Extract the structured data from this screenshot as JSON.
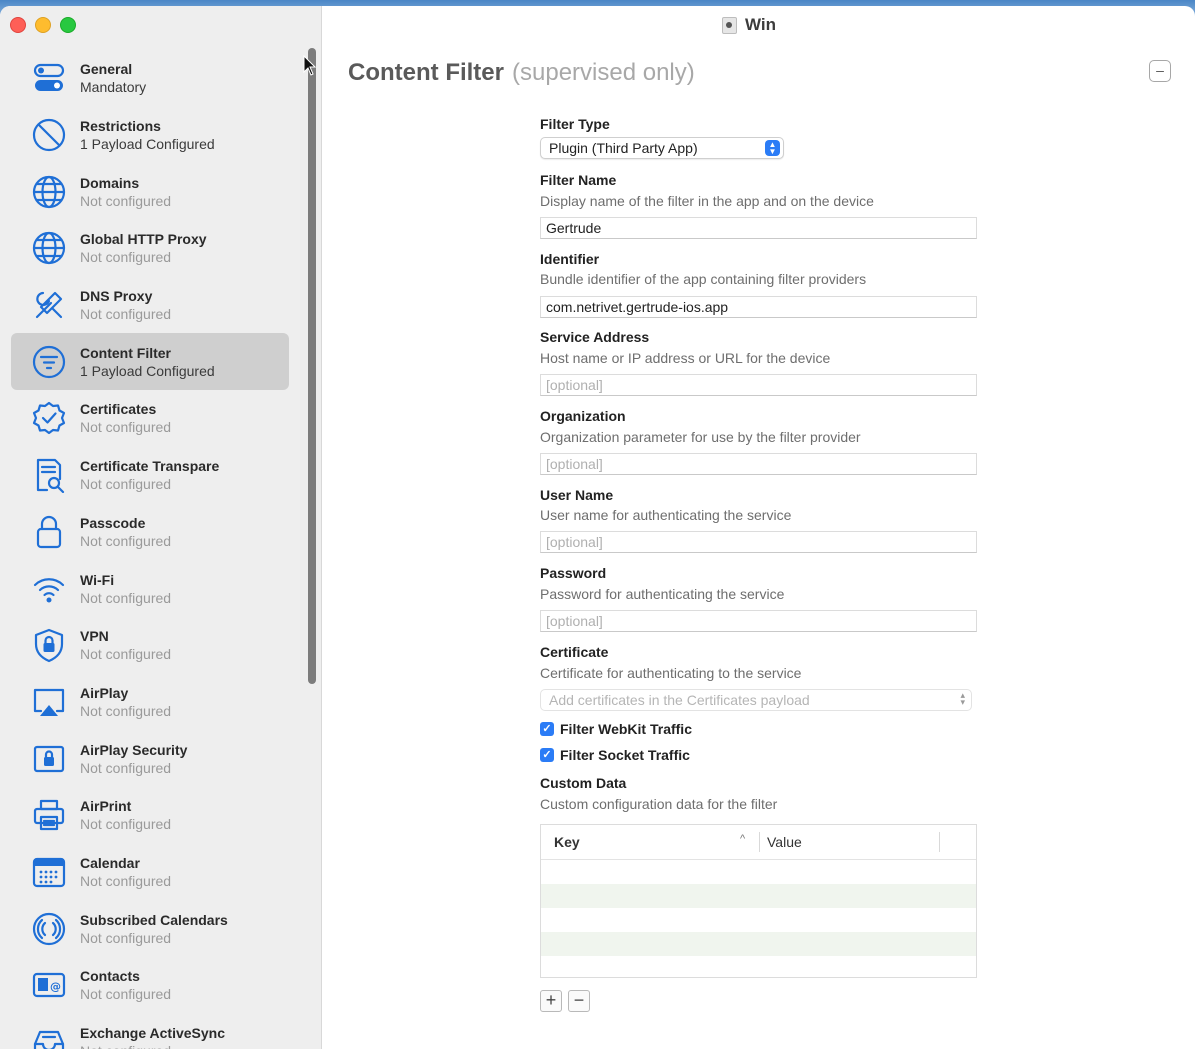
{
  "window": {
    "title": "Win"
  },
  "sidebar": {
    "items": [
      {
        "title": "General",
        "subtitle": "Mandatory",
        "icon": "toggle-icon",
        "configured": true
      },
      {
        "title": "Restrictions",
        "subtitle": "1 Payload Configured",
        "icon": "no-entry-icon",
        "configured": true
      },
      {
        "title": "Domains",
        "subtitle": "Not configured",
        "icon": "globe-icon",
        "configured": false
      },
      {
        "title": "Global HTTP Proxy",
        "subtitle": "Not configured",
        "icon": "globe-icon",
        "configured": false
      },
      {
        "title": "DNS Proxy",
        "subtitle": "Not configured",
        "icon": "tools-icon",
        "configured": false
      },
      {
        "title": "Content Filter",
        "subtitle": "1 Payload Configured",
        "icon": "filter-icon",
        "configured": true,
        "selected": true
      },
      {
        "title": "Certificates",
        "subtitle": "Not configured",
        "icon": "checkmark-seal-icon",
        "configured": false
      },
      {
        "title": "Certificate Transpare",
        "subtitle": "Not configured",
        "icon": "document-magnifier-icon",
        "configured": false
      },
      {
        "title": "Passcode",
        "subtitle": "Not configured",
        "icon": "lock-icon",
        "configured": false
      },
      {
        "title": "Wi-Fi",
        "subtitle": "Not configured",
        "icon": "wifi-icon",
        "configured": false
      },
      {
        "title": "VPN",
        "subtitle": "Not configured",
        "icon": "shield-lock-icon",
        "configured": false
      },
      {
        "title": "AirPlay",
        "subtitle": "Not configured",
        "icon": "airplay-icon",
        "configured": false
      },
      {
        "title": "AirPlay Security",
        "subtitle": "Not configured",
        "icon": "airplay-lock-icon",
        "configured": false
      },
      {
        "title": "AirPrint",
        "subtitle": "Not configured",
        "icon": "printer-icon",
        "configured": false
      },
      {
        "title": "Calendar",
        "subtitle": "Not configured",
        "icon": "calendar-icon",
        "configured": false
      },
      {
        "title": "Subscribed Calendars",
        "subtitle": "Not configured",
        "icon": "broadcast-icon",
        "configured": false
      },
      {
        "title": "Contacts",
        "subtitle": "Not configured",
        "icon": "contact-card-icon",
        "configured": false
      },
      {
        "title": "Exchange ActiveSync",
        "subtitle": "Not configured",
        "icon": "tray-icon",
        "configured": false
      }
    ]
  },
  "content": {
    "heading": "Content Filter",
    "heading_note": "(supervised only)",
    "collapse_label": "–",
    "filter_type": {
      "label": "Filter Type",
      "value": "Plugin (Third Party App)"
    },
    "filter_name": {
      "label": "Filter Name",
      "description": "Display name of the filter in the app and on the device",
      "value": "Gertrude"
    },
    "identifier": {
      "label": "Identifier",
      "description": "Bundle identifier of the app containing filter providers",
      "value": "com.netrivet.gertrude-ios.app"
    },
    "service_address": {
      "label": "Service Address",
      "description": "Host name or IP address or URL for the device",
      "placeholder": "[optional]"
    },
    "organization": {
      "label": "Organization",
      "description": "Organization parameter for use by the filter provider",
      "placeholder": "[optional]"
    },
    "user_name": {
      "label": "User Name",
      "description": "User name for authenticating the service",
      "placeholder": "[optional]"
    },
    "password": {
      "label": "Password",
      "description": "Password for authenticating the service",
      "placeholder": "[optional]"
    },
    "certificate": {
      "label": "Certificate",
      "description": "Certificate for authenticating to the service",
      "placeholder": "Add certificates in the Certificates payload"
    },
    "filter_webkit": {
      "label": "Filter WebKit Traffic",
      "checked": true
    },
    "filter_socket": {
      "label": "Filter Socket Traffic",
      "checked": true
    },
    "custom_data": {
      "label": "Custom Data",
      "description": "Custom configuration data for the filter",
      "columns": [
        "Key",
        "Value"
      ],
      "rows": []
    },
    "add_label": "+",
    "remove_label": "−"
  },
  "colors": {
    "accent": "#2b7cf6",
    "selection": "#cfcfcf",
    "icon": "#1f6fd6"
  }
}
